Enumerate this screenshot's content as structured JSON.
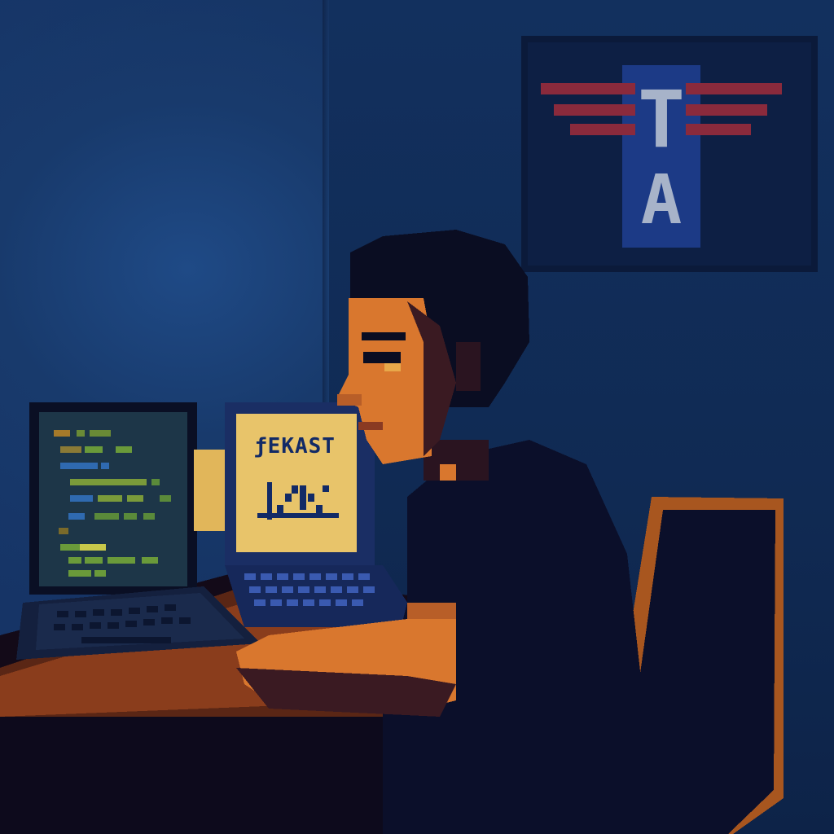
{
  "scene": {
    "description_free": true
  },
  "logo": {
    "letter_top": "T",
    "letter_bottom": "A",
    "icon": "winged-emblem-icon",
    "colors": {
      "panel": "#0b1a3a",
      "stripe": "#1c3a86",
      "wings": "#8a2a3c",
      "letters": "#a7b3c9"
    }
  },
  "code_screen": {
    "icon": "code-editor-icon"
  },
  "chart_screen": {
    "title_text": "ƒEKAST",
    "icon": "bell-curve-chart-icon"
  },
  "palette": {
    "wall": "#163466",
    "desk": "#8a3d1c",
    "skin": "#d9772e",
    "shirt": "#0b0f2a",
    "chair_edge": "#a8561f",
    "screen_glow": "#e8c46a"
  }
}
